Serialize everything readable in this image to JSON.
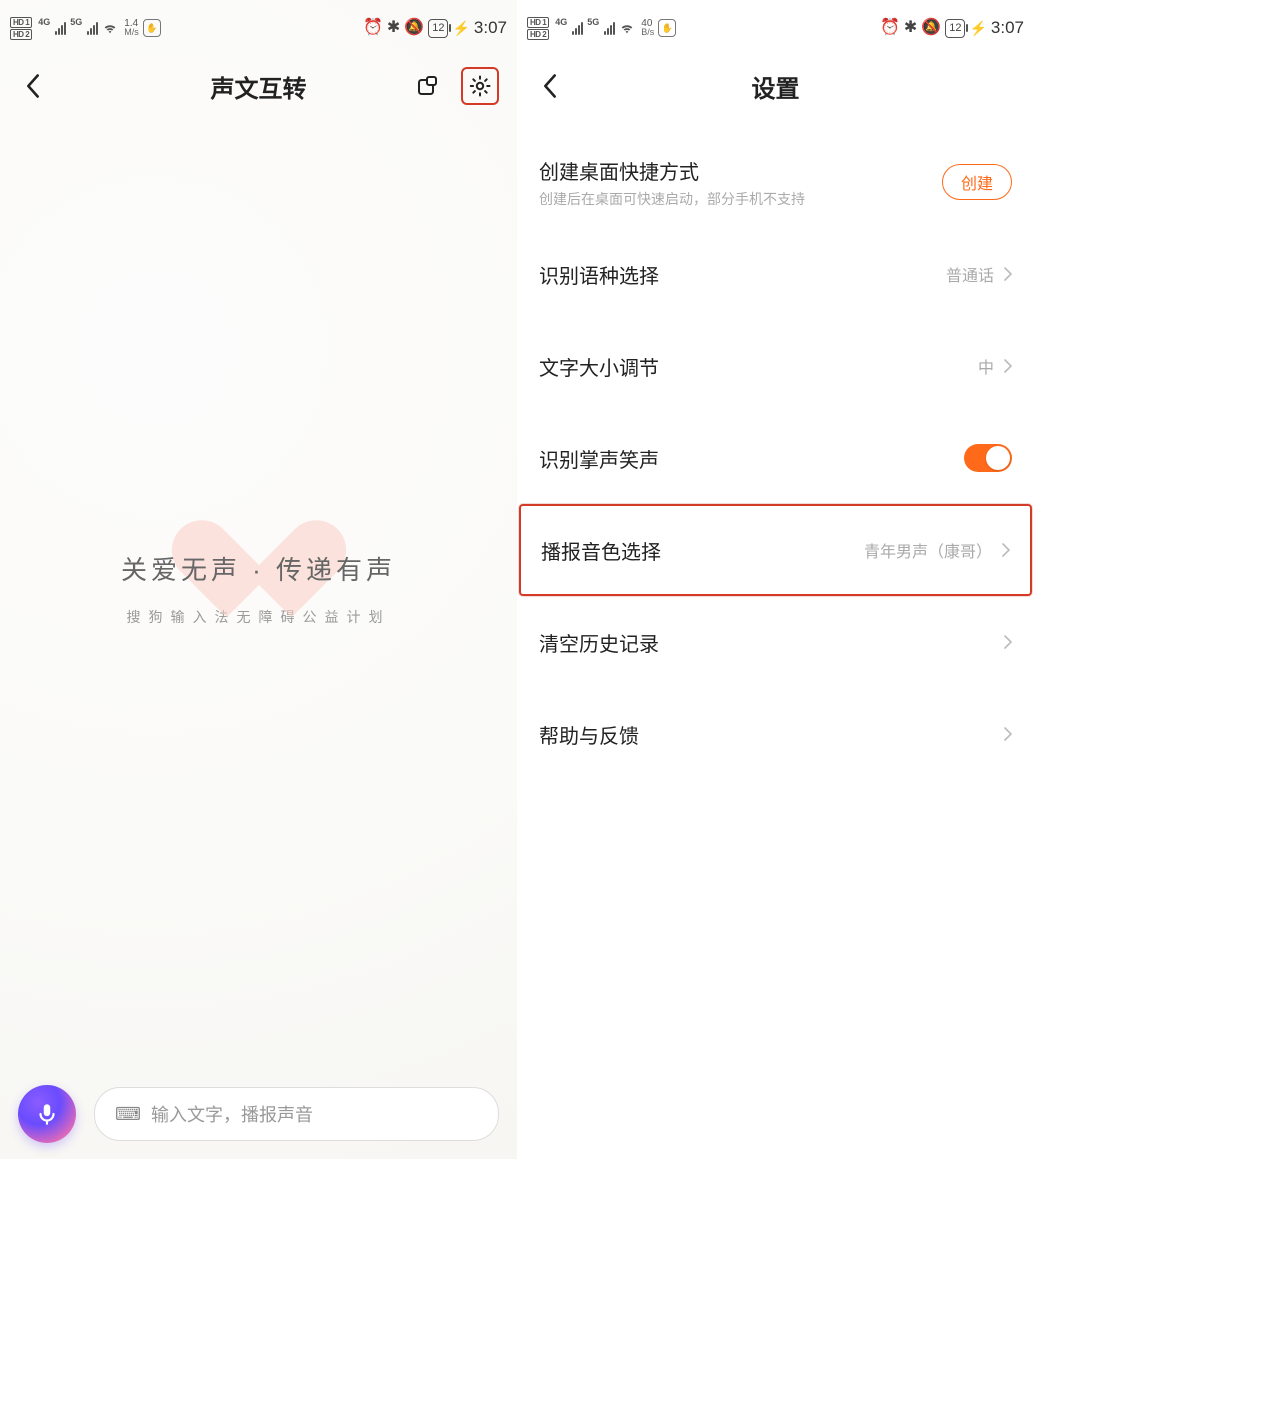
{
  "status": {
    "hd1": "HD 1",
    "hd2": "HD 2",
    "sig1_label": "4G",
    "sig2_label": "5G",
    "speed_left_value": "1.4",
    "speed_left_unit": "M/s",
    "speed_right_value": "40",
    "speed_right_unit": "B/s",
    "battery": "12",
    "time": "3:07"
  },
  "left": {
    "title": "声文互转",
    "slogan": "关爱无声 · 传递有声",
    "sub_slogan": "搜狗输入法无障碍公益计划",
    "input_placeholder": "输入文字，播报声音"
  },
  "right": {
    "title": "设置",
    "shortcut_title": "创建桌面快捷方式",
    "shortcut_sub": "创建后在桌面可快速启动，部分手机不支持",
    "shortcut_btn": "创建",
    "lang_title": "识别语种选择",
    "lang_value": "普通话",
    "fontsize_title": "文字大小调节",
    "fontsize_value": "中",
    "applause_title": "识别掌声笑声",
    "voice_title": "播报音色选择",
    "voice_value": "青年男声（康哥）",
    "clear_title": "清空历史记录",
    "help_title": "帮助与反馈"
  }
}
